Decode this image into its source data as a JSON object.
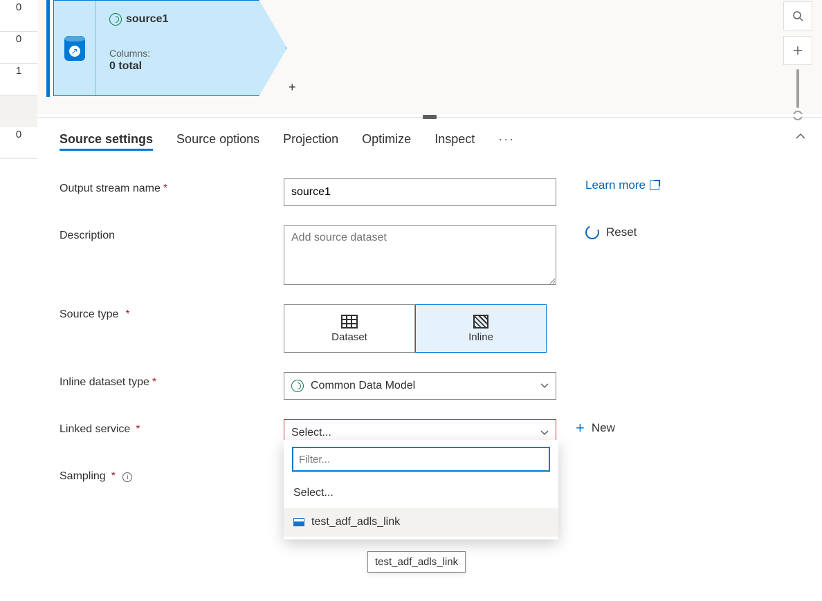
{
  "rail": [
    "0",
    "0",
    "1",
    "",
    "0"
  ],
  "node": {
    "title": "source1",
    "columns_label": "Columns:",
    "columns_count": "0 total"
  },
  "tabs": {
    "items": [
      "Source settings",
      "Source options",
      "Projection",
      "Optimize",
      "Inspect"
    ],
    "active": 0,
    "more": "···"
  },
  "form": {
    "output_stream_label": "Output stream name",
    "output_stream_value": "source1",
    "description_label": "Description",
    "description_placeholder": "Add source dataset",
    "source_type_label": "Source type",
    "source_type_options": {
      "dataset": "Dataset",
      "inline": "Inline"
    },
    "inline_dataset_label": "Inline dataset type",
    "inline_dataset_value": "Common Data Model",
    "linked_service_label": "Linked service",
    "linked_service_placeholder": "Select...",
    "sampling_label": "Sampling",
    "learn_more": "Learn more",
    "reset": "Reset",
    "new": "New"
  },
  "dropdown": {
    "filter_placeholder": "Filter...",
    "items": [
      {
        "label": "Select...",
        "kind": "placeholder"
      },
      {
        "label": "test_adf_adls_link",
        "kind": "service"
      }
    ]
  },
  "tooltip": "test_adf_adls_link"
}
